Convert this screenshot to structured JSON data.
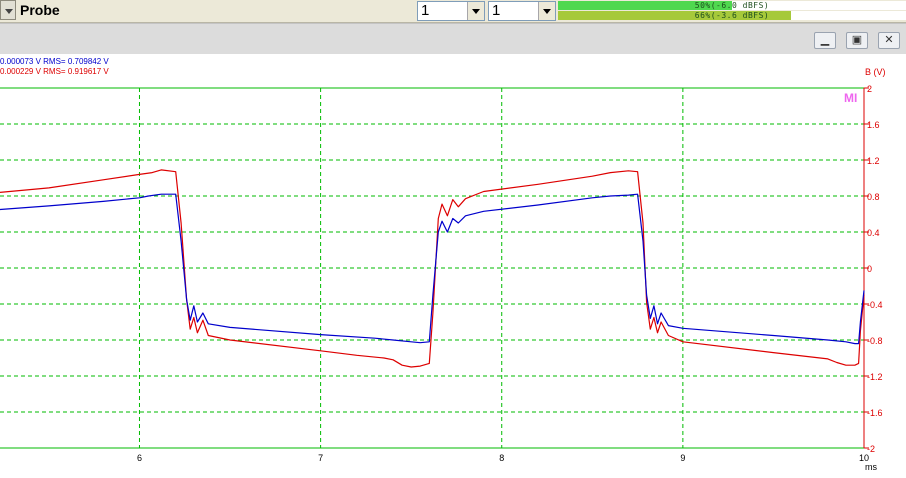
{
  "toolbar": {
    "probe_label": "Probe",
    "select_1": "1",
    "select_2": "1",
    "meter_1": {
      "text": "50%(-6.0 dBFS)",
      "level_percent": 50,
      "color": "#4fd84f"
    },
    "meter_2": {
      "text": "66%(-3.6 dBFS)",
      "level_percent": 67,
      "color": "#a6c93a"
    }
  },
  "window": {
    "minimize_glyph": "▁",
    "restore_glyph": "▣",
    "close_glyph": "✕"
  },
  "stats": {
    "channel_a": {
      "text": "0.000073 V  RMS= 0.709842 V",
      "color": "#0000cc"
    },
    "channel_b": {
      "text": "0.000229 V  RMS= 0.919617 V",
      "color": "#dd0000"
    }
  },
  "chart_data": {
    "type": "line",
    "x_unit_label": "ms",
    "right_axis_label": "B (V)",
    "marker_label": "MI",
    "xlim": [
      5.23,
      10
    ],
    "ylim": [
      -2,
      2
    ],
    "x_ticks": [
      6,
      7,
      8,
      9,
      10
    ],
    "y_ticks": [
      2,
      1.6,
      1.2,
      0.8,
      0.4,
      0,
      -0.4,
      -0.8,
      -1.2,
      -1.6,
      -2
    ],
    "grid": true,
    "grid_color": "#00bb00",
    "axis_color": "#dd0000",
    "series": [
      {
        "color": "#dd0000",
        "points": [
          [
            5.23,
            0.84
          ],
          [
            5.5,
            0.89
          ],
          [
            5.8,
            0.98
          ],
          [
            6.0,
            1.04
          ],
          [
            6.07,
            1.06
          ],
          [
            6.12,
            1.09
          ],
          [
            6.2,
            1.07
          ],
          [
            6.23,
            0.5
          ],
          [
            6.26,
            -0.35
          ],
          [
            6.28,
            -0.68
          ],
          [
            6.3,
            -0.55
          ],
          [
            6.32,
            -0.72
          ],
          [
            6.35,
            -0.58
          ],
          [
            6.38,
            -0.75
          ],
          [
            6.5,
            -0.8
          ],
          [
            7.0,
            -0.92
          ],
          [
            7.2,
            -0.97
          ],
          [
            7.35,
            -1.0
          ],
          [
            7.4,
            -1.02
          ],
          [
            7.45,
            -1.08
          ],
          [
            7.5,
            -1.1
          ],
          [
            7.55,
            -1.09
          ],
          [
            7.6,
            -1.06
          ],
          [
            7.62,
            -0.5
          ],
          [
            7.65,
            0.55
          ],
          [
            7.67,
            0.71
          ],
          [
            7.7,
            0.58
          ],
          [
            7.73,
            0.76
          ],
          [
            7.76,
            0.68
          ],
          [
            7.8,
            0.77
          ],
          [
            7.9,
            0.85
          ],
          [
            8.2,
            0.93
          ],
          [
            8.5,
            1.02
          ],
          [
            8.6,
            1.06
          ],
          [
            8.7,
            1.08
          ],
          [
            8.75,
            1.07
          ],
          [
            8.78,
            0.5
          ],
          [
            8.8,
            -0.38
          ],
          [
            8.82,
            -0.68
          ],
          [
            8.84,
            -0.55
          ],
          [
            8.86,
            -0.72
          ],
          [
            8.88,
            -0.6
          ],
          [
            8.92,
            -0.75
          ],
          [
            9.0,
            -0.82
          ],
          [
            9.5,
            -0.94
          ],
          [
            9.8,
            -1.01
          ],
          [
            9.85,
            -1.05
          ],
          [
            9.9,
            -1.08
          ],
          [
            9.95,
            -1.08
          ],
          [
            9.97,
            -1.06
          ],
          [
            9.98,
            -0.7
          ],
          [
            10.0,
            -0.3
          ]
        ]
      },
      {
        "color": "#0000cc",
        "points": [
          [
            5.23,
            0.65
          ],
          [
            5.5,
            0.69
          ],
          [
            5.8,
            0.74
          ],
          [
            6.0,
            0.78
          ],
          [
            6.05,
            0.8
          ],
          [
            6.12,
            0.82
          ],
          [
            6.2,
            0.82
          ],
          [
            6.23,
            0.3
          ],
          [
            6.26,
            -0.35
          ],
          [
            6.28,
            -0.58
          ],
          [
            6.3,
            -0.42
          ],
          [
            6.32,
            -0.6
          ],
          [
            6.35,
            -0.5
          ],
          [
            6.38,
            -0.62
          ],
          [
            6.5,
            -0.66
          ],
          [
            7.0,
            -0.74
          ],
          [
            7.3,
            -0.78
          ],
          [
            7.4,
            -0.8
          ],
          [
            7.5,
            -0.82
          ],
          [
            7.55,
            -0.83
          ],
          [
            7.6,
            -0.82
          ],
          [
            7.62,
            -0.3
          ],
          [
            7.65,
            0.4
          ],
          [
            7.67,
            0.52
          ],
          [
            7.7,
            0.4
          ],
          [
            7.73,
            0.55
          ],
          [
            7.76,
            0.5
          ],
          [
            7.8,
            0.58
          ],
          [
            7.9,
            0.63
          ],
          [
            8.2,
            0.7
          ],
          [
            8.5,
            0.78
          ],
          [
            8.6,
            0.8
          ],
          [
            8.7,
            0.81
          ],
          [
            8.75,
            0.82
          ],
          [
            8.78,
            0.3
          ],
          [
            8.8,
            -0.3
          ],
          [
            8.82,
            -0.56
          ],
          [
            8.84,
            -0.42
          ],
          [
            8.86,
            -0.62
          ],
          [
            8.88,
            -0.5
          ],
          [
            8.92,
            -0.64
          ],
          [
            9.0,
            -0.67
          ],
          [
            9.5,
            -0.75
          ],
          [
            9.8,
            -0.8
          ],
          [
            9.9,
            -0.82
          ],
          [
            9.95,
            -0.84
          ],
          [
            9.97,
            -0.84
          ],
          [
            9.98,
            -0.6
          ],
          [
            10.0,
            -0.25
          ]
        ]
      }
    ]
  }
}
